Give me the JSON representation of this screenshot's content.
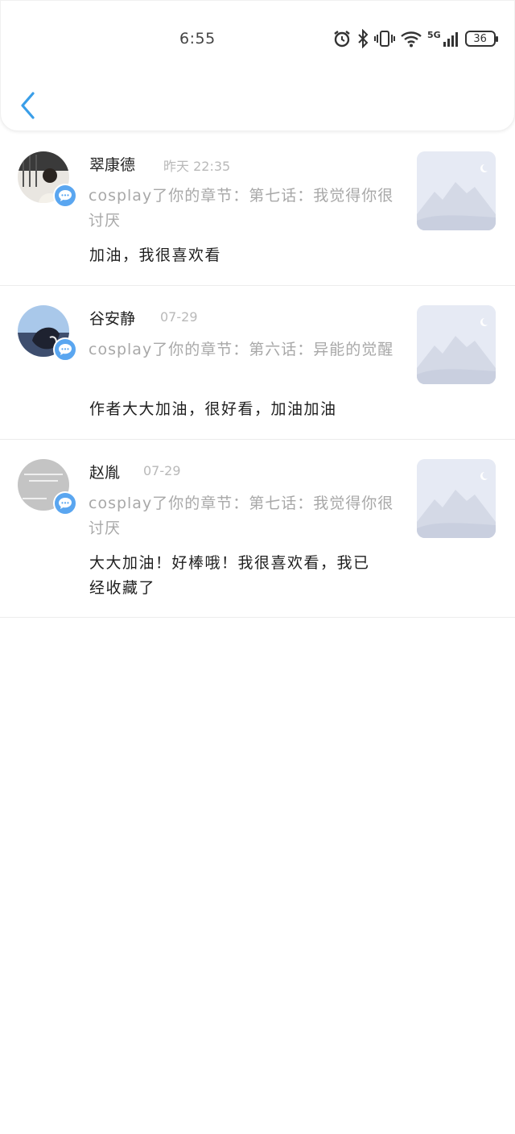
{
  "status_bar": {
    "time": "6:55",
    "battery": "36",
    "network": "5G",
    "icons": [
      "alarm-icon",
      "bluetooth-icon",
      "vibrate-icon",
      "wifi-icon",
      "signal-icon",
      "battery-icon"
    ]
  },
  "header": {
    "back_icon": "chevron-left-icon",
    "accent": "#3a9ee8"
  },
  "notifications": [
    {
      "name": "翠康德",
      "time": "昨天  22:35",
      "quote": "cosplay了你的章节：第七话：我觉得你很讨厌",
      "comment": "加油，我很喜欢看"
    },
    {
      "name": "谷安静",
      "time": "07-29",
      "quote": "cosplay了你的章节：第六话：异能的觉醒",
      "comment": "作者大大加油，很好看，加油加油"
    },
    {
      "name": "赵胤",
      "time": "07-29",
      "quote": "cosplay了你的章节：第七话：我觉得你很讨厌",
      "comment": "大大加油！好棒哦！我很喜欢看，我已经收藏了"
    }
  ]
}
